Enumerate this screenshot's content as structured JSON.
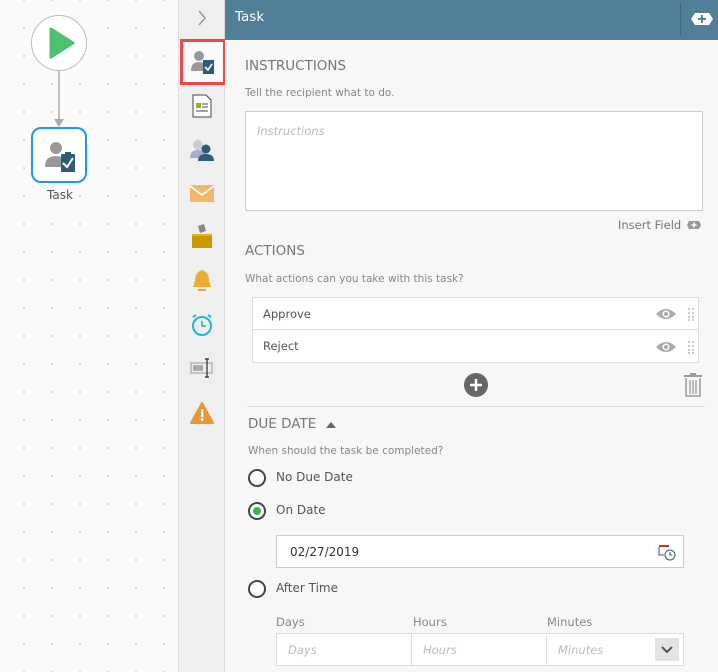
{
  "canvas": {
    "task_node_label": "Task"
  },
  "toolbar": {
    "collapse_icon": "chevron-right",
    "items": [
      "task",
      "form",
      "participants",
      "email",
      "vote",
      "alert",
      "timer",
      "field-input",
      "error"
    ]
  },
  "header": {
    "title": "Task"
  },
  "instructions": {
    "heading": "INSTRUCTIONS",
    "description": "Tell the recipient what to do.",
    "placeholder": "Instructions",
    "insert_field": "Insert Field"
  },
  "actions": {
    "heading": "ACTIONS",
    "description": "What actions can you take with this task?",
    "items": [
      {
        "label": "Approve"
      },
      {
        "label": "Reject"
      }
    ]
  },
  "due_date": {
    "heading": "DUE DATE",
    "description": "When should the task be completed?",
    "options": [
      {
        "label": "No Due Date",
        "selected": false
      },
      {
        "label": "On Date",
        "selected": true
      },
      {
        "label": "After Time",
        "selected": false
      }
    ],
    "date_value": "02/27/2019",
    "days_label": "Days",
    "hours_label": "Hours",
    "minutes_label": "Minutes",
    "days_placeholder": "Days",
    "hours_placeholder": "Hours",
    "minutes_placeholder": "Minutes"
  },
  "colors": {
    "header": "#527f98",
    "selected_outline": "#f0474c",
    "node_border": "#2196f3",
    "start": "#4cc26f",
    "radio_on": "#3cb44b"
  }
}
